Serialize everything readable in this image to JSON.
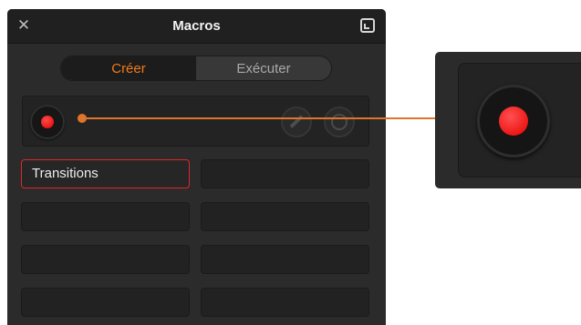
{
  "panel": {
    "title": "Macros",
    "close_glyph": "✕",
    "dock_icon": "dock-icon"
  },
  "tabs": [
    {
      "label": "Créer",
      "active": true
    },
    {
      "label": "Exécuter",
      "active": false
    }
  ],
  "record_bar": {
    "record_icon": "record-icon",
    "edit_icon": "pencil-icon",
    "stop_icon": "stop-ring-icon"
  },
  "slots": [
    {
      "label": "Transitions",
      "selected": true
    },
    {
      "label": "",
      "selected": false
    },
    {
      "label": "",
      "selected": false
    },
    {
      "label": "",
      "selected": false
    },
    {
      "label": "",
      "selected": false
    },
    {
      "label": "",
      "selected": false
    },
    {
      "label": "",
      "selected": false
    },
    {
      "label": "",
      "selected": false
    }
  ],
  "colors": {
    "accent": "#f07a1a",
    "record_red": "#e00000",
    "callout": "#e0752a",
    "selected_border": "#e0252a"
  }
}
